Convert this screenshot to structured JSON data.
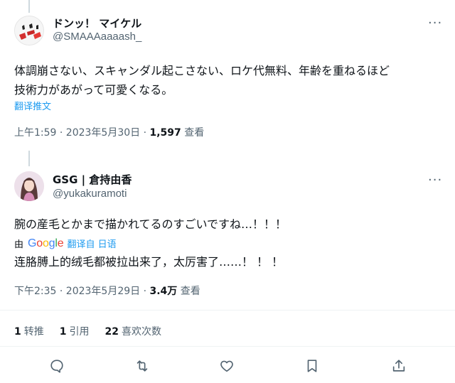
{
  "tweet1": {
    "display_name": "ドンッ！ マイケル",
    "handle": "@SMAAAaaaash_",
    "text_line1": "体調崩さない、スキャンダル起こさない、ロケ代無料、年齢を重ねるほど",
    "text_line2": "技術力があがって可愛くなる。",
    "translate_label": "翻译推文",
    "time": "上午1:59 · 2023年5月30日 · ",
    "views_count": "1,597",
    "views_label": "查看",
    "more_icon": "more-horizontal-icon"
  },
  "tweet2": {
    "display_name": "GSG | 倉持由香",
    "handle": "@yukakuramoti",
    "text": "腕の産毛とかまで描かれてるのすごいですね…！！！",
    "google_prefix": "由",
    "google_logo": [
      "G",
      "o",
      "o",
      "g",
      "l",
      "e"
    ],
    "google_colors": [
      "#4285f4",
      "#ea4335",
      "#fbbc05",
      "#4285f4",
      "#34a853",
      "#ea4335"
    ],
    "google_translate_label": "翻译自 日语",
    "translated_text": "连胳膊上的绒毛都被拉出来了，太厉害了……！ ！ ！",
    "time": "下午2:35 · 2023年5月29日 · ",
    "views_count": "3.4万",
    "views_label": "查看",
    "stats": {
      "retweets_count": "1",
      "retweets_label": "转推",
      "quotes_count": "1",
      "quotes_label": "引用",
      "likes_count": "22",
      "likes_label": "喜欢次数"
    },
    "more_icon": "more-horizontal-icon"
  },
  "actions": [
    "reply-icon",
    "retweet-icon",
    "like-icon",
    "bookmark-icon",
    "share-icon"
  ],
  "colors": {
    "link": "#1d9bf0",
    "secondary_text": "#536471",
    "primary_text": "#0f1419",
    "divider": "#eff3f4"
  }
}
